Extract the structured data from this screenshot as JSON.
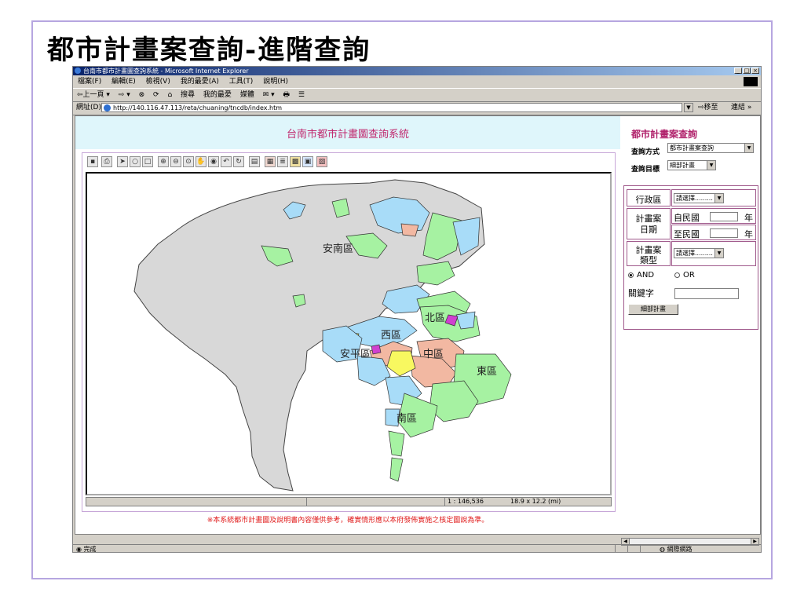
{
  "slide": {
    "title": "都市計畫案查詢-進階查詢"
  },
  "window": {
    "title": "台南市都市計畫圖查詢系統 - Microsoft Internet Explorer",
    "controls": {
      "min": "_",
      "max": "□",
      "close": "×"
    }
  },
  "menu": [
    "檔案(F)",
    "編輯(E)",
    "檢視(V)",
    "我的最愛(A)",
    "工具(T)",
    "說明(H)"
  ],
  "toolbar": [
    "⇦上一頁 ▾",
    "⇨ ▾",
    "⊗",
    "⟳",
    "⌂",
    "搜尋",
    "我的最愛",
    "媒體",
    "✉ ▾",
    "🖶",
    "☰"
  ],
  "address": {
    "label": "網址(D)",
    "url": "http://140.116.47.113/reta/chuaning/tncdb/index.htm",
    "go_label": "移至",
    "links_label": "連結 »"
  },
  "main": {
    "header": "台南市都市計畫圖查詢系統",
    "notice": "※本系統都市計畫圖及說明書內容僅供參考，確實情形應以本府發佈實施之核定圖說為準。"
  },
  "map": {
    "labels": [
      "安南區",
      "北區",
      "西區",
      "安平區",
      "中區",
      "東區",
      "南區"
    ],
    "scale_text": "1 : 146,536",
    "size_text": "18.9 x 12.2 (mi)",
    "colors": {
      "land": "#d8d8d8",
      "blue": "#a8dcf8",
      "green": "#a6f2a2",
      "salmon": "#f2b8a2",
      "yellow": "#f8f860",
      "magenta": "#d040d0"
    }
  },
  "sidebar": {
    "title": "都市計畫案查詢",
    "query_method_label": "查詢方式",
    "query_method_value": "都市計畫案查詢",
    "query_target_label": "查詢目標",
    "query_target_value": "細部計畫",
    "district_label": "行政區",
    "district_value": "請選擇.........",
    "date_label_1": "計畫案",
    "date_label_2": "日期",
    "date_from_prefix": "自民國",
    "date_to_prefix": "至民國",
    "year_unit": "年",
    "type_label_1": "計畫案",
    "type_label_2": "類型",
    "type_value": "請選擇.........",
    "radio_and": "AND",
    "radio_or": "OR",
    "keyword_label": "關鍵字",
    "submit_label": "細部計畫"
  },
  "status": {
    "done": "完成",
    "zone": "網際網路"
  }
}
